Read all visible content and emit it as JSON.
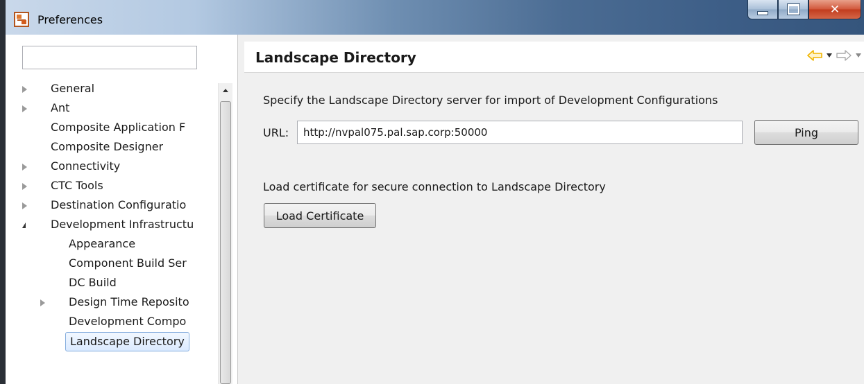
{
  "window": {
    "title": "Preferences"
  },
  "left_panel": {
    "filter": {
      "value": ""
    },
    "tree": [
      {
        "label": "General",
        "indent": 0,
        "twisty": "closed"
      },
      {
        "label": "Ant",
        "indent": 0,
        "twisty": "closed"
      },
      {
        "label": "Composite Application F",
        "indent": 0,
        "twisty": "none"
      },
      {
        "label": "Composite Designer",
        "indent": 0,
        "twisty": "none"
      },
      {
        "label": "Connectivity",
        "indent": 0,
        "twisty": "closed"
      },
      {
        "label": "CTC Tools",
        "indent": 0,
        "twisty": "closed"
      },
      {
        "label": "Destination Configuratio",
        "indent": 0,
        "twisty": "closed"
      },
      {
        "label": "Development Infrastructu",
        "indent": 0,
        "twisty": "open"
      },
      {
        "label": "Appearance",
        "indent": 1,
        "twisty": "none"
      },
      {
        "label": "Component Build Ser",
        "indent": 1,
        "twisty": "none"
      },
      {
        "label": "DC Build",
        "indent": 1,
        "twisty": "none"
      },
      {
        "label": "Design Time Reposito",
        "indent": 1,
        "twisty": "closed"
      },
      {
        "label": "Development Compo",
        "indent": 1,
        "twisty": "none"
      },
      {
        "label": "Landscape Directory",
        "indent": 1,
        "twisty": "none",
        "selected": true
      }
    ]
  },
  "main": {
    "title": "Landscape Directory",
    "description": "Specify the Landscape Directory server for import of Development Configurations",
    "url_label": "URL:",
    "url_value": "http://nvpal075.pal.sap.corp:50000",
    "ping_label": "Ping",
    "cert_description": "Load certificate for secure connection to Landscape Directory",
    "cert_button_label": "Load Certificate"
  },
  "colors": {
    "back_arrow": "#f0b400",
    "forward_arrow_disabled": "#a9a9a9",
    "selection_border": "#84acdd"
  },
  "icons": {
    "back": "back-arrow-icon",
    "forward": "forward-arrow-icon",
    "close": "close-icon",
    "minimize": "minimize-icon",
    "maximize": "maximize-icon"
  }
}
